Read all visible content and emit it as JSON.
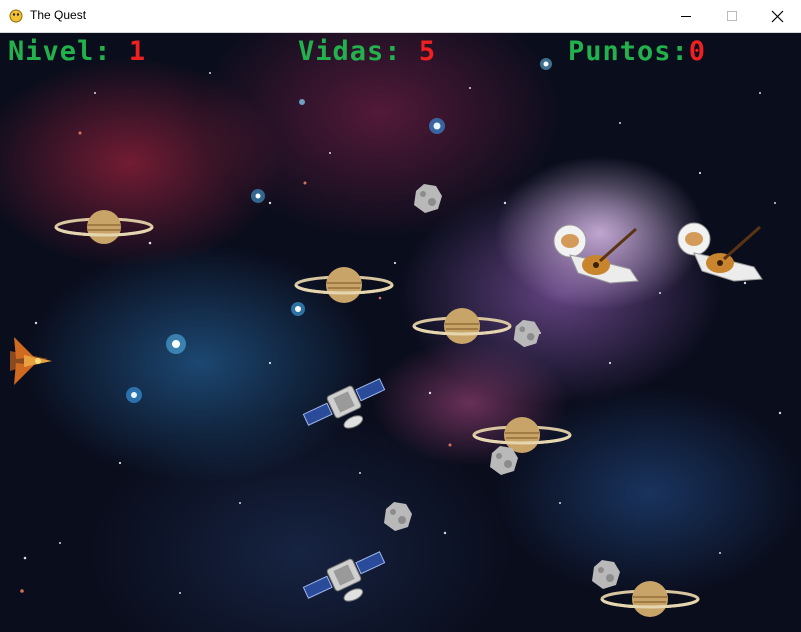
{
  "window": {
    "title": "The Quest"
  },
  "hud": {
    "level_label": "Nivel:",
    "level_value": "1",
    "lives_label": "Vidas:",
    "lives_value": "5",
    "score_label": "Puntos:",
    "score_value": "0"
  },
  "icons": {
    "app": "pygame-snake-icon",
    "minimize": "minimize-icon",
    "maximize": "maximize-icon",
    "close": "close-icon"
  },
  "colors": {
    "hud_label": "#22b14c",
    "hud_value": "#ee2020"
  }
}
